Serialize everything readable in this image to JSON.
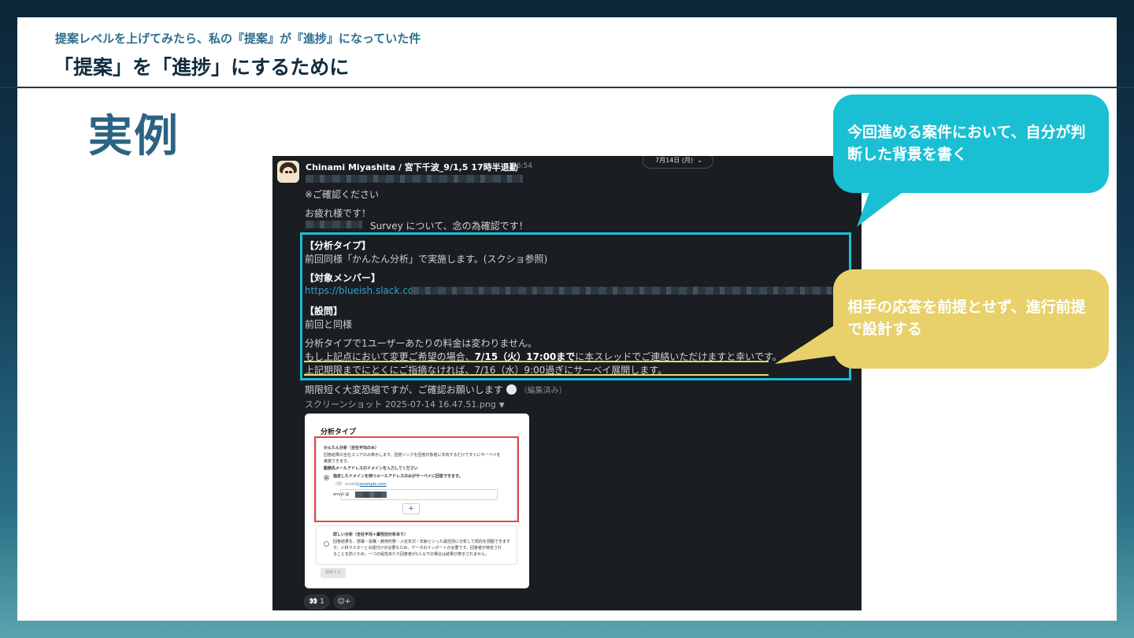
{
  "slide": {
    "subtitle": "提案レベルを上げてみたら、私の『提案』が『進捗』になっていた件",
    "title": "「提案」を「進捗」にするために",
    "section": "実例"
  },
  "message": {
    "sender": "Chinami Miyashita / 宮下千波_9/1,5 17時半退勤",
    "time": "16:54",
    "date_pill": "7月14日 (月)",
    "date_caret": "⌄",
    "lines": {
      "confirm": "※ご確認ください",
      "greeting": "お疲れ様です！",
      "survey": "Survey について、念の為確認です！",
      "h_type": "【分析タイプ】",
      "type_body": "前回同様「かんたん分析」で実施します。(スクショ参照)",
      "h_member": "【対象メンバー】",
      "member_link": "https://blueish.slack.com/",
      "h_question": "【設問】",
      "question_body": "前回と同様",
      "price": "分析タイプで1ユーザーあたりの料金は変わりません。",
      "change_pre": "もし上記点において変更ご希望の場合、",
      "change_bold": "7/15（火）17:00まで",
      "change_post": "に本スレッドでご連絡いただけますと幸いです。",
      "deadline": "上記期限までにとくにご指摘なければ、7/16（水）9:00過ぎにサーベイ展開します。",
      "closing": "期限短く大変恐縮ですが、ご確認お願いします",
      "edited": "（編集済み）",
      "attachment": "スクリーンショット 2025-07-14 16.47.51.png",
      "attachment_caret": "▼"
    },
    "preview": {
      "title": "分析タイプ",
      "opt1_title": "かんたん分析（全社平均のみ）",
      "opt1_desc1": "回答結果の全社スコアのみ表示します。回答リンクを回答対象者に共有するだけですぐにサーベイを",
      "opt1_desc2": "実施できます。",
      "opt1_domain_label": "勤務先メールアドレスのドメインを入力してください",
      "opt1_domain_desc": "指定したドメインを持つメールアドレスのみがサーベイに回答できます。",
      "opt1_example_pre": "（例）email@",
      "opt1_example_link": "example.com",
      "email_label": "email @",
      "plus": "+",
      "opt2_title": "詳しい分析（全社平均＋属性別分析あり）",
      "opt2_desc1": "回答結果を、部署・役職・雇用形態・入社年次・年齢といった属性別に分析して傾向を把握できます",
      "opt2_desc2": "す。人材マスターとの紐付けが必要なため、データのインポートが必要です。回答者が特定され",
      "opt2_desc3": "ることを防ぐため、一つの属性あたり回答者が1人以下の場合は結果が表示されません。",
      "save": "保存する"
    },
    "reactions": {
      "eyes": "👀 1",
      "add": "☺+"
    }
  },
  "callouts": {
    "teal": "今回進める案件において、自分が判断した背景を書く",
    "gold": "相手の応答を前提とせず、進行前提で設計する"
  },
  "colors": {
    "accent_teal": "#1bbfd3",
    "accent_gold": "#e8d06a",
    "title_blue": "#2b6383"
  }
}
